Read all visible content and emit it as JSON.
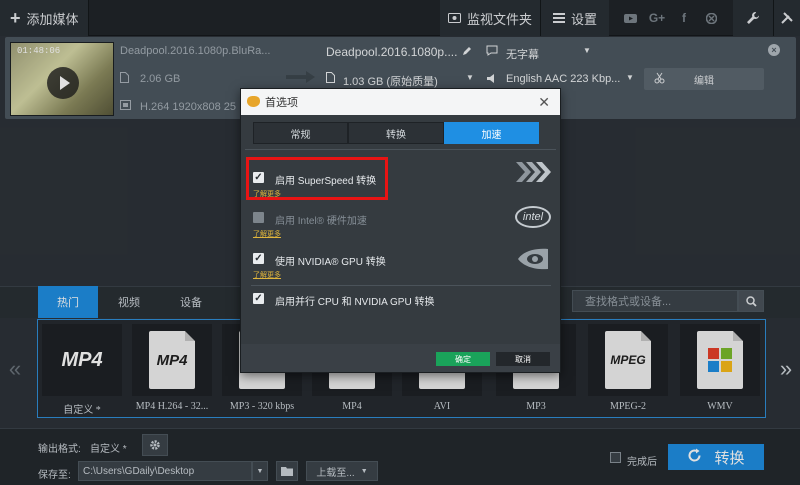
{
  "topbar": {
    "add_media": "添加媒体",
    "watch_folder": "监视文件夹",
    "settings": "设置",
    "social": [
      "youtube-icon",
      "google-plus-icon",
      "facebook-icon",
      "vk-icon"
    ]
  },
  "file": {
    "duration": "01:48:06",
    "source_name": "Deadpool.2016.1080p.BluRa...",
    "source_size": "2.06 GB",
    "source_codec": "H.264 1920x808 25",
    "output_name": "Deadpool.2016.1080p....",
    "output_size": "1.03 GB (原始质量)",
    "subtitle": "无字幕",
    "audio": "English AAC 223 Kbp...",
    "edit_label": "编辑"
  },
  "categories": {
    "tabs": [
      "热门",
      "视频",
      "设备"
    ],
    "search_placeholder": "查找格式或设备..."
  },
  "formats": [
    {
      "icon": "MP4",
      "label": "自定义 *"
    },
    {
      "icon": "MP4",
      "label": "MP4 H.264 - 32..."
    },
    {
      "icon": "MP3",
      "label": "MP3 - 320 kbps"
    },
    {
      "icon": "MP4",
      "label": "MP4"
    },
    {
      "icon": "AVI",
      "label": "AVI"
    },
    {
      "icon": "MP3",
      "label": "MP3"
    },
    {
      "icon": "MPEG",
      "label": "MPEG-2"
    },
    {
      "icon": "WMV",
      "label": "WMV"
    }
  ],
  "bottom": {
    "output_format_label": "输出格式:",
    "output_format_value": "自定义 *",
    "save_to_label": "保存至:",
    "save_path": "C:\\Users\\GDaily\\Desktop",
    "upload_label": "上载至...",
    "after_done": "完成后",
    "convert": "转换"
  },
  "dialog": {
    "title": "首选项",
    "tabs": [
      "常规",
      "转换",
      "加速"
    ],
    "options": [
      {
        "label": "启用 SuperSpeed 转换",
        "learn": "了解更多",
        "checked": true,
        "enabled": true
      },
      {
        "label": "启用 Intel® 硬件加速",
        "learn": "了解更多",
        "checked": false,
        "enabled": false
      },
      {
        "label": "使用 NVIDIA® GPU 转换",
        "learn": "了解更多",
        "checked": true,
        "enabled": true
      },
      {
        "label": "启用并行 CPU 和 NVIDIA GPU 转换",
        "checked": true,
        "enabled": true
      }
    ],
    "intel_logo": "intel",
    "ok": "确定",
    "cancel": "取消"
  },
  "colors": {
    "accent": "#1f8fe3",
    "highlight": "#e81414",
    "ok_button": "#1aa35a"
  }
}
